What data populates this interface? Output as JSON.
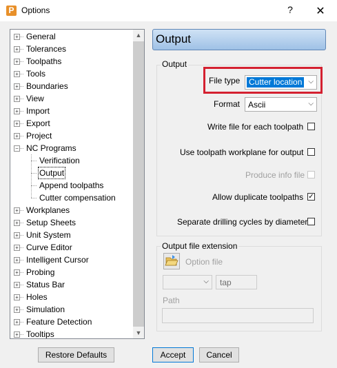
{
  "window": {
    "title": "Options",
    "app_icon": "P",
    "help_glyph": "?",
    "close_glyph": "✕"
  },
  "tree": {
    "items": [
      {
        "label": "General",
        "level": 0,
        "expander": "+"
      },
      {
        "label": "Tolerances",
        "level": 0,
        "expander": "+"
      },
      {
        "label": "Toolpaths",
        "level": 0,
        "expander": "+"
      },
      {
        "label": "Tools",
        "level": 0,
        "expander": "+"
      },
      {
        "label": "Boundaries",
        "level": 0,
        "expander": "+"
      },
      {
        "label": "View",
        "level": 0,
        "expander": "+"
      },
      {
        "label": "Import",
        "level": 0,
        "expander": "+"
      },
      {
        "label": "Export",
        "level": 0,
        "expander": "+"
      },
      {
        "label": "Project",
        "level": 0,
        "expander": "+"
      },
      {
        "label": "NC Programs",
        "level": 0,
        "expander": "−"
      },
      {
        "label": "Verification",
        "level": 1
      },
      {
        "label": "Output",
        "level": 1,
        "selected": true
      },
      {
        "label": "Append toolpaths",
        "level": 1
      },
      {
        "label": "Cutter compensation",
        "level": 1
      },
      {
        "label": "Workplanes",
        "level": 0,
        "expander": "+"
      },
      {
        "label": "Setup Sheets",
        "level": 0,
        "expander": "+"
      },
      {
        "label": "Unit System",
        "level": 0,
        "expander": "+"
      },
      {
        "label": "Curve Editor",
        "level": 0,
        "expander": "+"
      },
      {
        "label": "Intelligent Cursor",
        "level": 0,
        "expander": "+"
      },
      {
        "label": "Probing",
        "level": 0,
        "expander": "+"
      },
      {
        "label": "Status Bar",
        "level": 0,
        "expander": "+"
      },
      {
        "label": "Holes",
        "level": 0,
        "expander": "+"
      },
      {
        "label": "Simulation",
        "level": 0,
        "expander": "+"
      },
      {
        "label": "Feature Detection",
        "level": 0,
        "expander": "+"
      },
      {
        "label": "Tooltips",
        "level": 0,
        "expander": "+"
      }
    ],
    "scroll_up": "▲",
    "scroll_down": "▼"
  },
  "panel": {
    "header": "Output",
    "output_group": {
      "title": "Output",
      "file_type_label": "File type",
      "file_type_value": "Cutter location",
      "format_label": "Format",
      "format_value": "Ascii",
      "write_file_label": "Write file for each toolpath",
      "write_file_checked": false,
      "use_workplane_label": "Use toolpath workplane for output",
      "use_workplane_checked": false,
      "produce_info_label": "Produce info file",
      "produce_info_checked": false,
      "allow_duplicate_label": "Allow duplicate toolpaths",
      "allow_duplicate_checked": true,
      "separate_drilling_label": "Separate drilling cycles by diameter",
      "separate_drilling_checked": false,
      "check_glyph": "✓"
    },
    "extension_group": {
      "title": "Output file extension",
      "option_file_label": "Option file",
      "extension_combo_value": "",
      "extension_value": "tap",
      "path_label": "Path",
      "path_value": ""
    }
  },
  "buttons": {
    "restore_defaults": "Restore Defaults",
    "accept": "Accept",
    "cancel": "Cancel"
  },
  "colors": {
    "accent_selection": "#0078d7",
    "highlight_border": "#d42030",
    "header_gradient_top": "#cfe2f5",
    "header_gradient_bottom": "#9fc1e6"
  },
  "glyphs": {
    "dropdown_arrow": "⌵"
  }
}
